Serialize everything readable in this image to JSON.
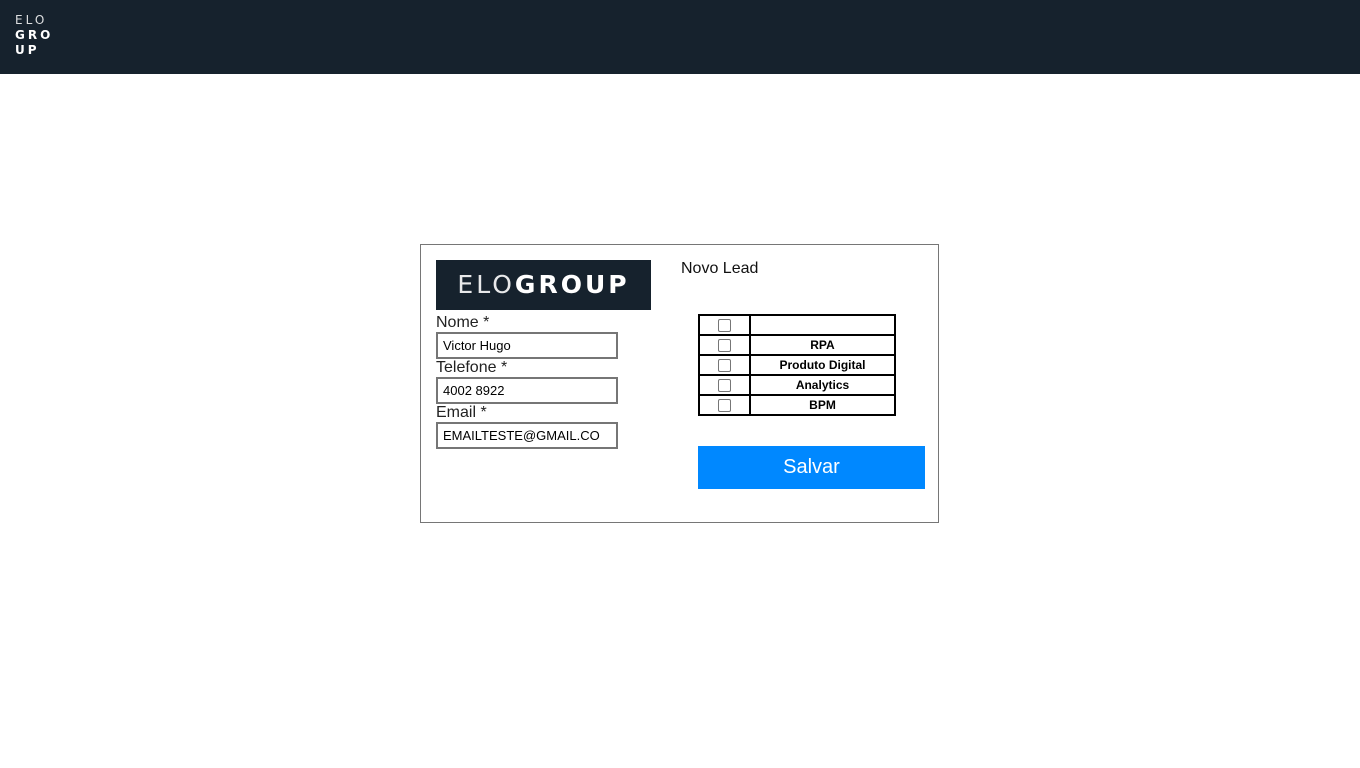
{
  "header": {
    "logo_line1": "ELO",
    "logo_line2": "GRO",
    "logo_line3": "UP"
  },
  "card": {
    "logo_thin": "ELO",
    "logo_bold": "GROUP",
    "title": "Novo Lead"
  },
  "form": {
    "nome_label": "Nome *",
    "nome_value": "Victor Hugo",
    "telefone_label": "Telefone *",
    "telefone_value": "4002 8922",
    "email_label": "Email *",
    "email_value": "EMAILTESTE@GMAIL.CO"
  },
  "services": {
    "rows": [
      {
        "label": "",
        "checked": false
      },
      {
        "label": "RPA",
        "checked": false
      },
      {
        "label": "Produto Digital",
        "checked": false
      },
      {
        "label": "Analytics",
        "checked": false
      },
      {
        "label": "BPM",
        "checked": false
      }
    ]
  },
  "actions": {
    "save_label": "Salvar"
  },
  "colors": {
    "brand_dark": "#16222d",
    "accent": "#0088ff"
  }
}
